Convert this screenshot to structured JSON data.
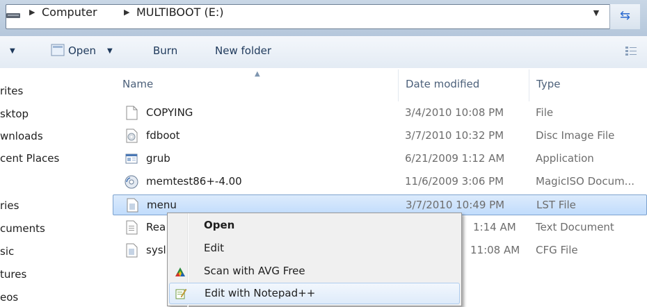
{
  "address_bar": {
    "crumbs": [
      "Computer",
      "MULTIBOOT (E:)"
    ]
  },
  "toolbar": {
    "open_label": "Open",
    "burn_label": "Burn",
    "new_folder_label": "New folder"
  },
  "nav_pane": {
    "items": [
      "rites",
      "sktop",
      "wnloads",
      "cent Places",
      "ries",
      "cuments",
      "sic",
      "tures",
      "eos"
    ]
  },
  "file_list": {
    "columns": [
      "Name",
      "Date modified",
      "Type"
    ],
    "rows": [
      {
        "name": "COPYING",
        "date": "3/4/2010 10:08 PM",
        "type": "File",
        "icon": "blank-file-icon"
      },
      {
        "name": "fdboot",
        "date": "3/7/2010 10:32 PM",
        "type": "Disc Image File",
        "icon": "disc-image-icon"
      },
      {
        "name": "grub",
        "date": "6/21/2009 1:12 AM",
        "type": "Application",
        "icon": "application-icon"
      },
      {
        "name": "memtest86+-4.00",
        "date": "11/6/2009 3:06 PM",
        "type": "MagicISO Docum...",
        "icon": "magiciso-icon"
      },
      {
        "name": "menu",
        "date": "3/7/2010 10:49 PM",
        "type": "LST File",
        "icon": "text-file-icon",
        "selected": true
      },
      {
        "name": "Rea",
        "date": "1:14 AM",
        "type": "Text Document",
        "icon": "text-file-icon"
      },
      {
        "name": "sysl",
        "date": "11:08 AM",
        "type": "CFG File",
        "icon": "config-file-icon"
      }
    ]
  },
  "context_menu": {
    "items": [
      {
        "label": "Open",
        "bold": true,
        "icon": ""
      },
      {
        "label": "Edit",
        "bold": false,
        "icon": ""
      },
      {
        "label": "Scan with AVG Free",
        "bold": false,
        "icon": "avg-icon"
      },
      {
        "label": "Edit with Notepad++",
        "bold": false,
        "icon": "notepadpp-icon",
        "hover": true
      }
    ]
  },
  "colors": {
    "selection": "#c1dcfc",
    "menu_hover_border": "#aeccee",
    "toolbar_text": "#1e395b"
  }
}
